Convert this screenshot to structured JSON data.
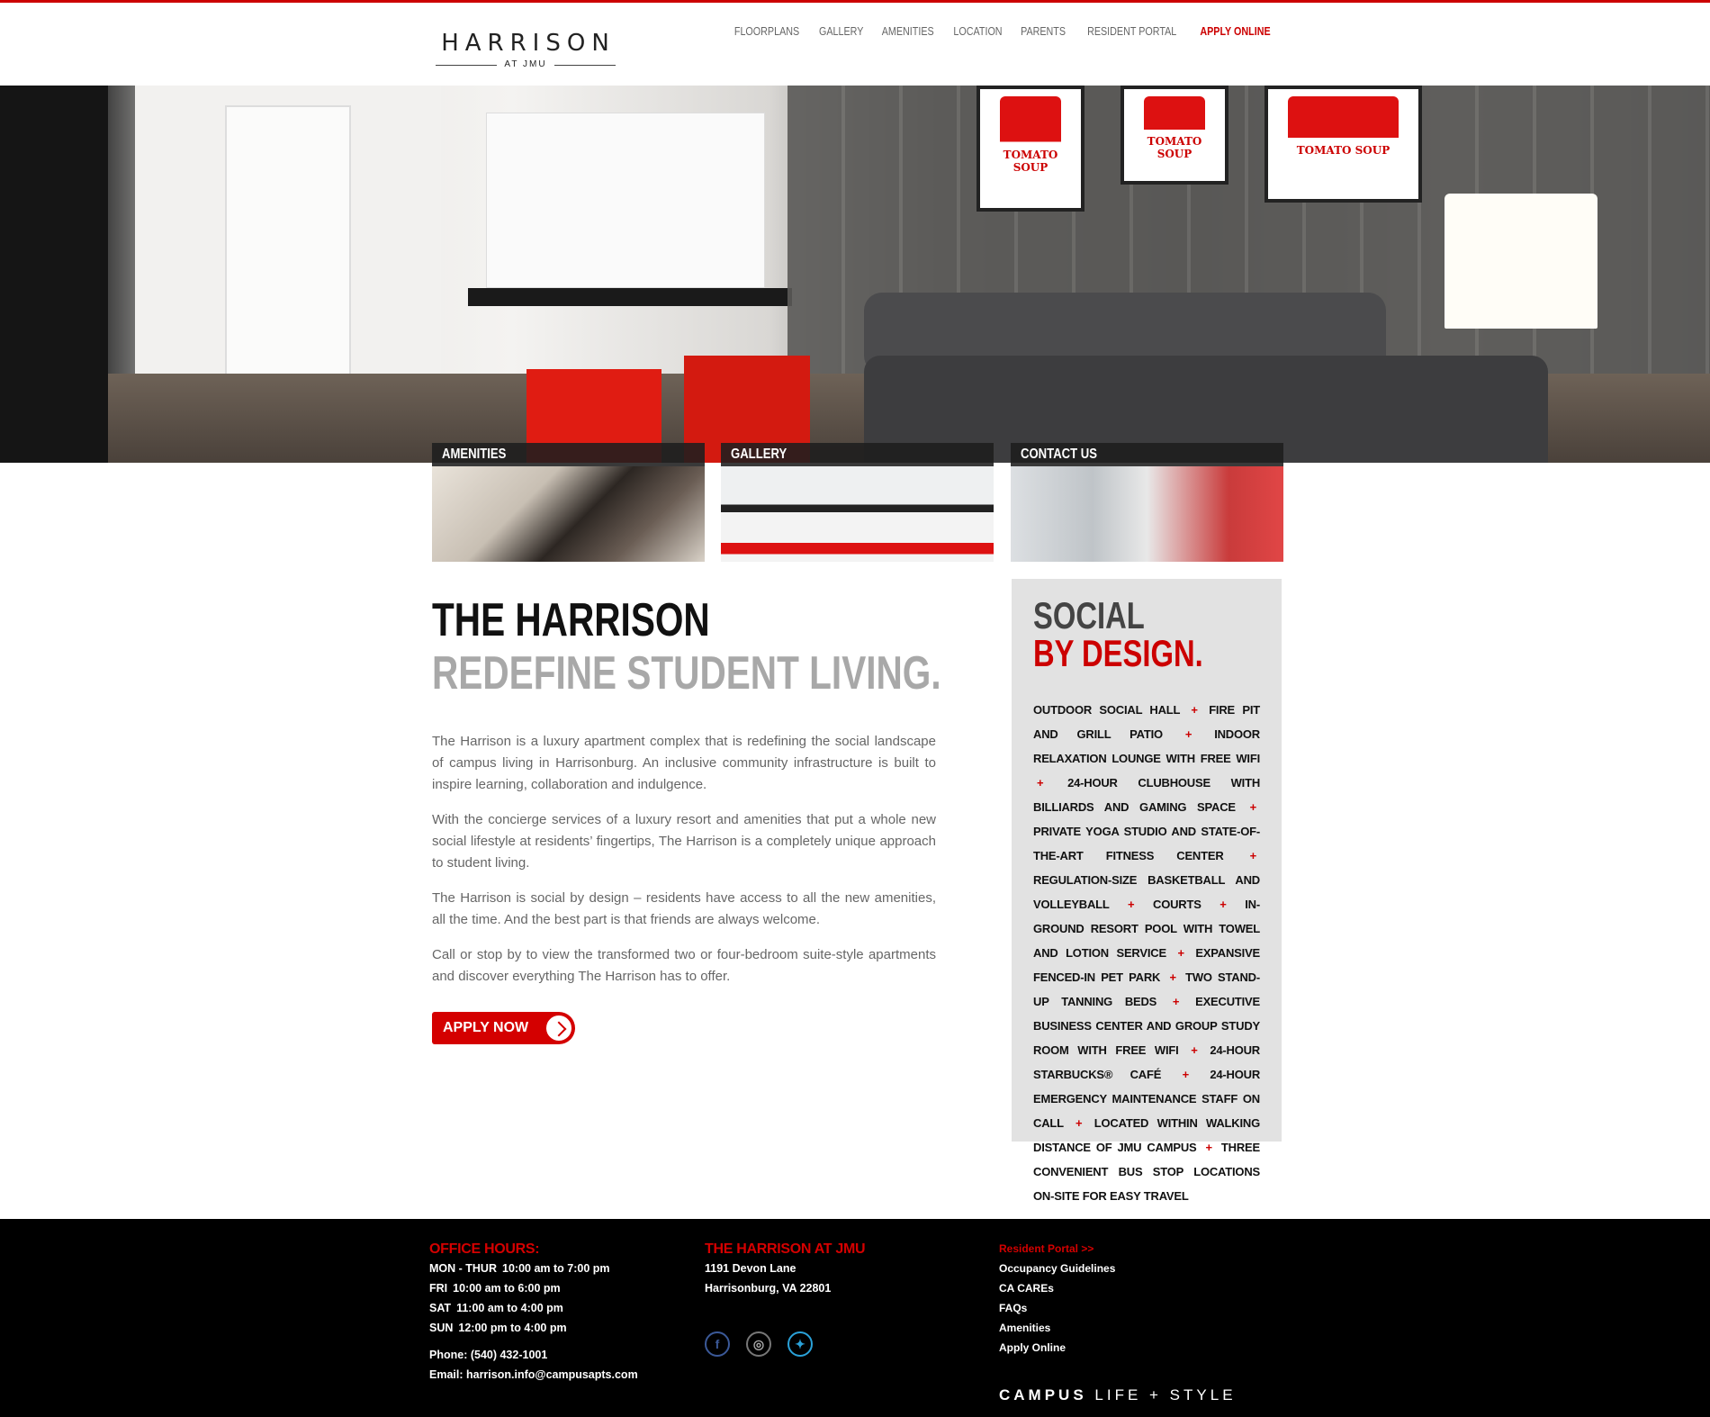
{
  "colors": {
    "accent": "#cc0000",
    "footer_bg": "#000000",
    "sidebar_bg": "#e2e2e2"
  },
  "logo": {
    "main": "HARRISON",
    "sub": "AT JMU"
  },
  "nav": {
    "items": [
      "FLOORPLANS",
      "GALLERY",
      "AMENITIES",
      "LOCATION",
      "PARENTS",
      "RESIDENT PORTAL"
    ],
    "apply": "APPLY ONLINE"
  },
  "hero": {
    "posters": [
      "TOMATO SOUP",
      "TOMATO SOUP",
      "TOMATO SOUP"
    ]
  },
  "tiles": [
    {
      "label": "AMENITIES"
    },
    {
      "label": "GALLERY"
    },
    {
      "label": "CONTACT US"
    }
  ],
  "main": {
    "title": "THE HARRISON",
    "subtitle": "REDEFINE STUDENT LIVING.",
    "paragraphs": [
      "The Harrison is a luxury apartment complex that is redefining the social landscape of campus living in Harrisonburg. An inclusive community infrastructure is built to inspire learning, collaboration and indulgence.",
      "With the concierge services of a luxury resort and amenities that put a whole new social lifestyle at residents’ fingertips, The Harrison is a completely unique approach to student living.",
      "The Harrison is social by design – residents have access to all the new amenities, all the time. And the best part is that friends are always welcome.",
      "Call or stop by to view the transformed two or four-bedroom suite-style apartments and discover everything The Harrison has to offer."
    ],
    "apply_button": "APPLY NOW"
  },
  "sidebar": {
    "heading1": "SOCIAL",
    "heading2": "BY DESIGN.",
    "amenities": [
      "OUTDOOR SOCIAL HALL",
      "FIRE PIT AND GRILL PATIO",
      "INDOOR RELAXATION LOUNGE WITH FREE WIFI",
      "24-HOUR CLUBHOUSE WITH BILLIARDS AND GAMING SPACE",
      "PRIVATE YOGA STUDIO AND STATE-OF-THE-ART FITNESS CENTER",
      "REGULATION-SIZE BASKETBALL AND VOLLEYBALL",
      "COURTS",
      "IN-GROUND RESORT POOL WITH TOWEL AND LOTION SERVICE",
      "EXPANSIVE FENCED-IN PET PARK",
      "TWO STAND-UP TANNING BEDS",
      "EXECUTIVE BUSINESS CENTER AND GROUP STUDY ROOM WITH FREE WIFI",
      "24-HOUR STARBUCKS® CAFÉ",
      "24-HOUR EMERGENCY MAINTENANCE STAFF ON CALL",
      "LOCATED WITHIN WALKING DISTANCE OF JMU CAMPUS",
      "THREE CONVENIENT BUS STOP LOCATIONS ON-SITE FOR EASY TRAVEL"
    ],
    "separator": "+"
  },
  "footer": {
    "hours_title": "OFFICE HOURS:",
    "hours": [
      {
        "day": "MON - THUR",
        "time": "10:00 am to 7:00 pm"
      },
      {
        "day": "FRI",
        "time": "10:00 am to 6:00 pm"
      },
      {
        "day": "SAT",
        "time": "11:00 am to 4:00 pm"
      },
      {
        "day": "SUN",
        "time": "12:00 pm to 4:00 pm"
      }
    ],
    "phone": "Phone: (540) 432-1001",
    "email": "Email: harrison.info@campusapts.com",
    "address_title": "THE HARRISON AT JMU",
    "address_line1": "1191 Devon Lane",
    "address_line2": "Harrisonburg, VA 22801",
    "social_icons": [
      "facebook-icon",
      "instagram-icon",
      "twitter-icon"
    ],
    "links": [
      {
        "label": "Resident Portal >>",
        "accent": true
      },
      {
        "label": "Occupancy Guidelines"
      },
      {
        "label": "CA CAREs"
      },
      {
        "label": "FAQs"
      },
      {
        "label": "Amenities"
      },
      {
        "label": "Apply Online"
      }
    ],
    "brand_bold": "CAMPUS",
    "brand_rest": "LIFE + STYLE"
  }
}
